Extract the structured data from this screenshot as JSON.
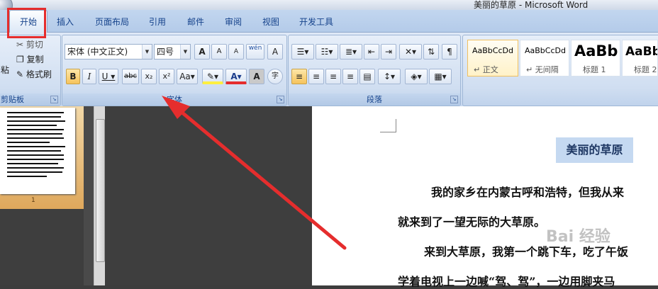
{
  "window": {
    "title": "美丽的草原 - Microsoft Word"
  },
  "tabs": [
    "开始",
    "插入",
    "页面布局",
    "引用",
    "邮件",
    "审阅",
    "视图",
    "开发工具"
  ],
  "clipboard": {
    "cut": "剪切",
    "copy": "复制",
    "format_painter": "格式刷",
    "paste": "粘",
    "label": "剪贴板"
  },
  "font": {
    "name": "宋体 (中文正文)",
    "size": "四号",
    "label": "字体",
    "bold": "B",
    "italic": "I",
    "underline": "U",
    "strike": "abc",
    "subscript": "x₂",
    "superscript": "x²",
    "case": "Aa",
    "grow": "A",
    "shrink": "A",
    "phonetic": "wén",
    "border": "A",
    "clear_format": "A",
    "shading": "A",
    "enclose": "字"
  },
  "paragraph": {
    "label": "段落"
  },
  "styles": [
    {
      "preview": "AaBbCcDd",
      "name": "↵ 正文"
    },
    {
      "preview": "AaBbCcDd",
      "name": "↵ 无间隔"
    },
    {
      "preview": "AaBb",
      "name": "标题 1"
    },
    {
      "preview": "AaBb",
      "name": "标题 2"
    }
  ],
  "thumbnail": {
    "page_number": "1"
  },
  "document": {
    "title": "美丽的草原",
    "lines": [
      "我的家乡在内蒙古呼和浩特，但我从来",
      "就来到了一望无际的大草原。",
      "来到大草原，我第一个跳下车，吃了午饭",
      "学着电视上一边喊“驾、驾”，一边用脚夹马"
    ]
  },
  "watermark": "Bai 经验",
  "colors": {
    "highlight_red": "#e52d2d",
    "ribbon_blue": "#c7d8ef",
    "title_shade": "#c5d9f1"
  }
}
